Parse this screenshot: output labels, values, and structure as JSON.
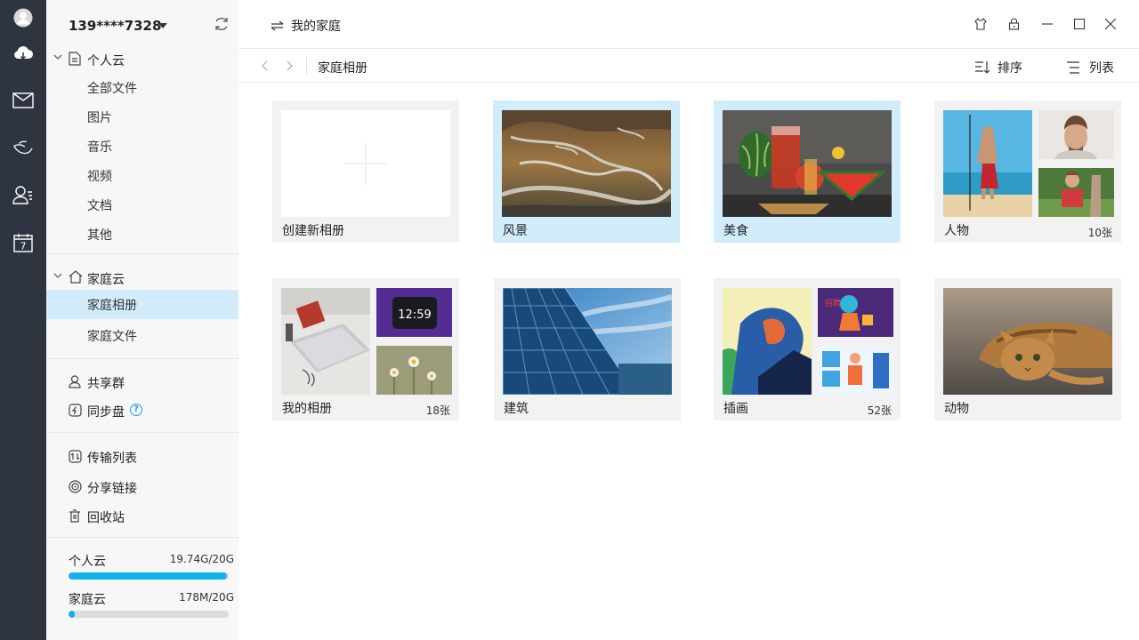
{
  "rail": {
    "icons": [
      "avatar-icon",
      "cloud-icon",
      "mail-icon",
      "tea-icon",
      "contacts-icon",
      "calendar-icon"
    ],
    "calendar_day": "7"
  },
  "sidebar": {
    "account": "139****7328",
    "personal_cloud": {
      "label": "个人云",
      "items": [
        "全部文件",
        "图片",
        "音乐",
        "视频",
        "文档",
        "其他"
      ]
    },
    "family_cloud": {
      "label": "家庭云",
      "items": [
        "家庭相册",
        "家庭文件"
      ],
      "active": "家庭相册"
    },
    "share_group": "共享群",
    "sync_disk": "同步盘",
    "help_mark": "?",
    "tools": [
      "传输列表",
      "分享链接",
      "回收站"
    ],
    "quota": [
      {
        "name": "个人云",
        "value": "19.74G/20G",
        "fraction": 0.987
      },
      {
        "name": "家庭云",
        "value": "178M/20G",
        "fraction": 0.009
      }
    ]
  },
  "titlebar": {
    "family_name": "我的家庭"
  },
  "pathbar": {
    "crumb": "家庭相册",
    "sort_label": "排序",
    "view_label": "列表"
  },
  "albums": [
    {
      "name": "创建新相册",
      "count": "",
      "kind": "create"
    },
    {
      "name": "风景",
      "count": "",
      "kind": "landscape",
      "selected": true
    },
    {
      "name": "美食",
      "count": "",
      "kind": "food",
      "selected": true
    },
    {
      "name": "人物",
      "count": "10张",
      "kind": "people"
    },
    {
      "name": "我的相册",
      "count": "18张",
      "kind": "mine"
    },
    {
      "name": "建筑",
      "count": "",
      "kind": "building"
    },
    {
      "name": "插画",
      "count": "52张",
      "kind": "illustration"
    },
    {
      "name": "动物",
      "count": "",
      "kind": "animal"
    }
  ],
  "colors": {
    "rail": "#2f3441",
    "accent": "#13b0f0",
    "selected": "#d1ecfb",
    "active_nav": "#d3ecfb"
  }
}
